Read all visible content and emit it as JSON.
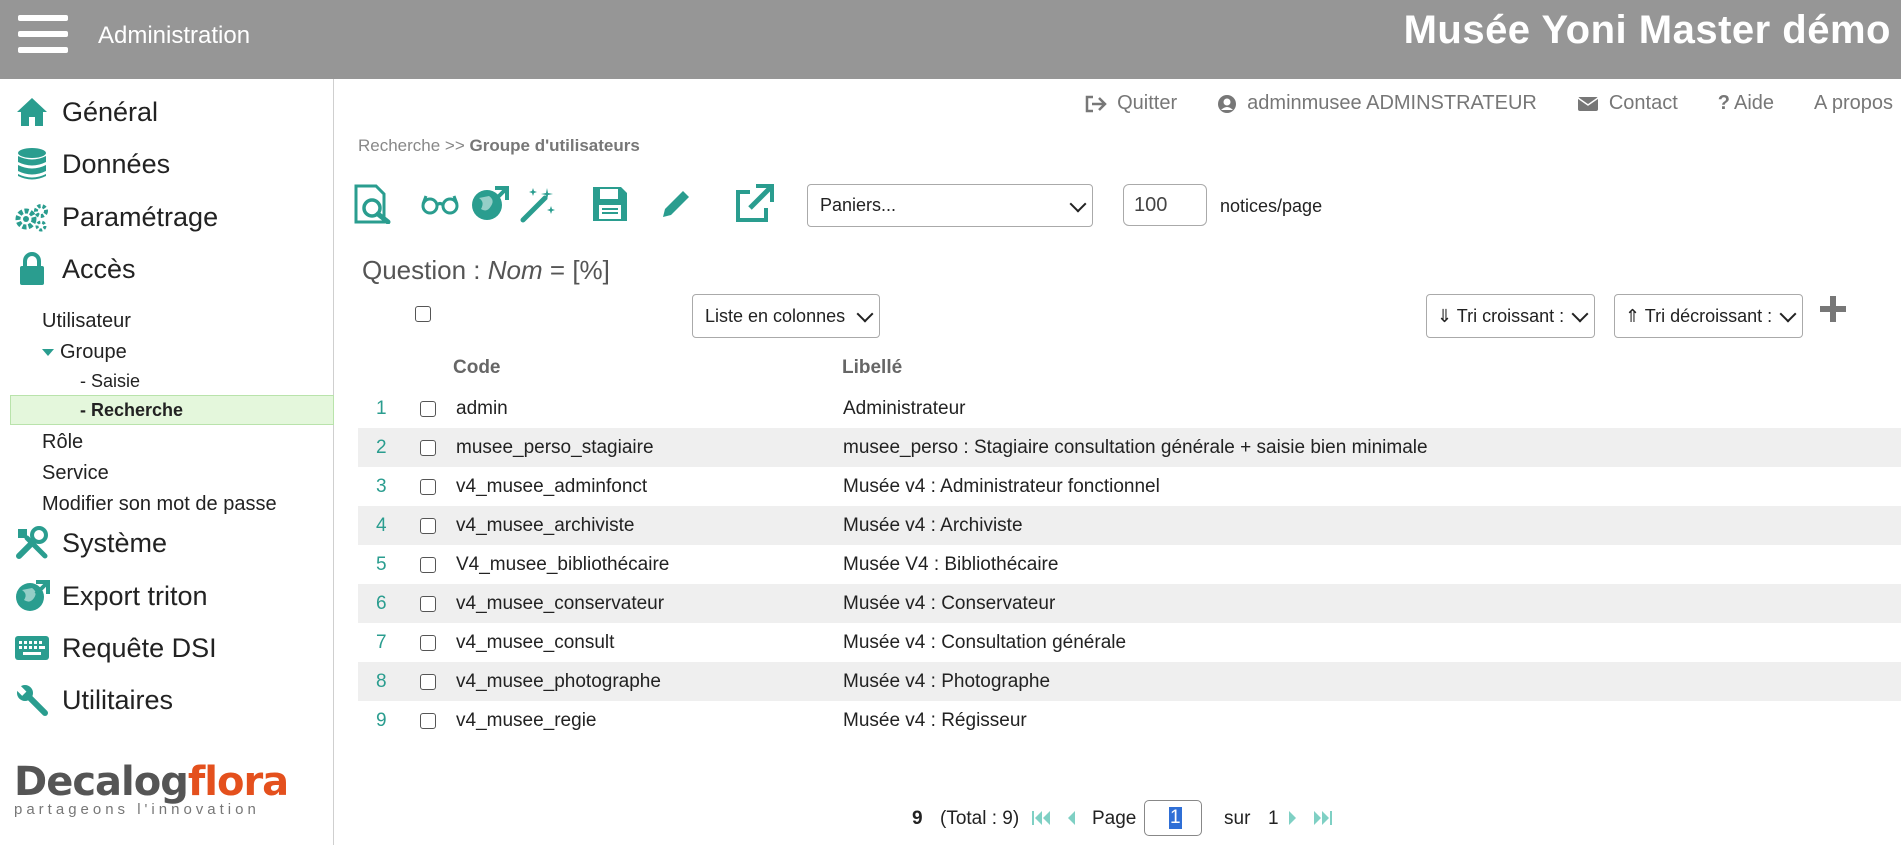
{
  "header": {
    "section": "Administration",
    "app_title": "Musée Yoni Master démo"
  },
  "sidebar": {
    "menu": [
      {
        "label": "Général",
        "icon": "home-icon"
      },
      {
        "label": "Données",
        "icon": "database-icon"
      },
      {
        "label": "Paramétrage",
        "icon": "gears-icon"
      },
      {
        "label": "Accès",
        "icon": "lock-icon"
      },
      {
        "label": "Système",
        "icon": "tools-icon"
      },
      {
        "label": "Export triton",
        "icon": "globe-export-icon"
      },
      {
        "label": "Requête DSI",
        "icon": "keyboard-icon"
      },
      {
        "label": "Utilitaires",
        "icon": "wrench-icon"
      }
    ],
    "sub": {
      "utilisateur": "Utilisateur",
      "groupe": "Groupe",
      "saisie": "- Saisie",
      "recherche": "- Recherche",
      "role": "Rôle",
      "service": "Service",
      "password": "Modifier son mot de passe"
    },
    "logo": {
      "word1": "Decalog",
      "word2": "flora",
      "tagline": "partageons l'innovation"
    }
  },
  "topnav": {
    "quit": "Quitter",
    "user": "adminmusee ADMINSTRATEUR",
    "contact": "Contact",
    "help": "Aide",
    "about": "A propos"
  },
  "breadcrumb": {
    "parent": "Recherche >>",
    "current": "Groupe d'utilisateurs"
  },
  "toolbar": {
    "baskets_select": "Paniers...",
    "per_page_value": "100",
    "per_page_label": "notices/page",
    "tools": [
      "search-preview-icon",
      "glasses-icon",
      "globe-export-icon",
      "magic-wand-icon",
      "save-icon",
      "pencil-icon",
      "external-link-icon"
    ]
  },
  "question": {
    "prefix": "Question :",
    "field": "Nom",
    "op": "=",
    "value": "[%]"
  },
  "list_controls": {
    "display_select": "Liste en colonnes",
    "sort_asc": "⇓ Tri croissant :",
    "sort_desc": "⇑ Tri décroissant :"
  },
  "table": {
    "headers": {
      "code": "Code",
      "label": "Libellé"
    },
    "rows": [
      {
        "n": "1",
        "code": "admin",
        "label": "Administrateur"
      },
      {
        "n": "2",
        "code": "musee_perso_stagiaire",
        "label": "musee_perso : Stagiaire consultation générale + saisie bien minimale"
      },
      {
        "n": "3",
        "code": "v4_musee_adminfonct",
        "label": "Musée v4 : Administrateur fonctionnel"
      },
      {
        "n": "4",
        "code": "v4_musee_archiviste",
        "label": "Musée v4 : Archiviste"
      },
      {
        "n": "5",
        "code": "V4_musee_bibliothécaire",
        "label": "Musée V4 : Bibliothécaire"
      },
      {
        "n": "6",
        "code": "v4_musee_conservateur",
        "label": "Musée v4 : Conservateur"
      },
      {
        "n": "7",
        "code": "v4_musee_consult",
        "label": "Musée v4 : Consultation générale"
      },
      {
        "n": "8",
        "code": "v4_musee_photographe",
        "label": "Musée v4 : Photographe"
      },
      {
        "n": "9",
        "code": "v4_musee_regie",
        "label": "Musée v4 : Régisseur"
      }
    ]
  },
  "pagination": {
    "count": "9",
    "total": "(Total : 9)",
    "page_label": "Page",
    "page_value": "1",
    "of_label": "sur",
    "page_count": "1"
  },
  "colors": {
    "accent": "#2a9d8f",
    "header_bg": "#969696",
    "active_bg": "#e4f7dc",
    "logo_orange": "#e4501d"
  }
}
